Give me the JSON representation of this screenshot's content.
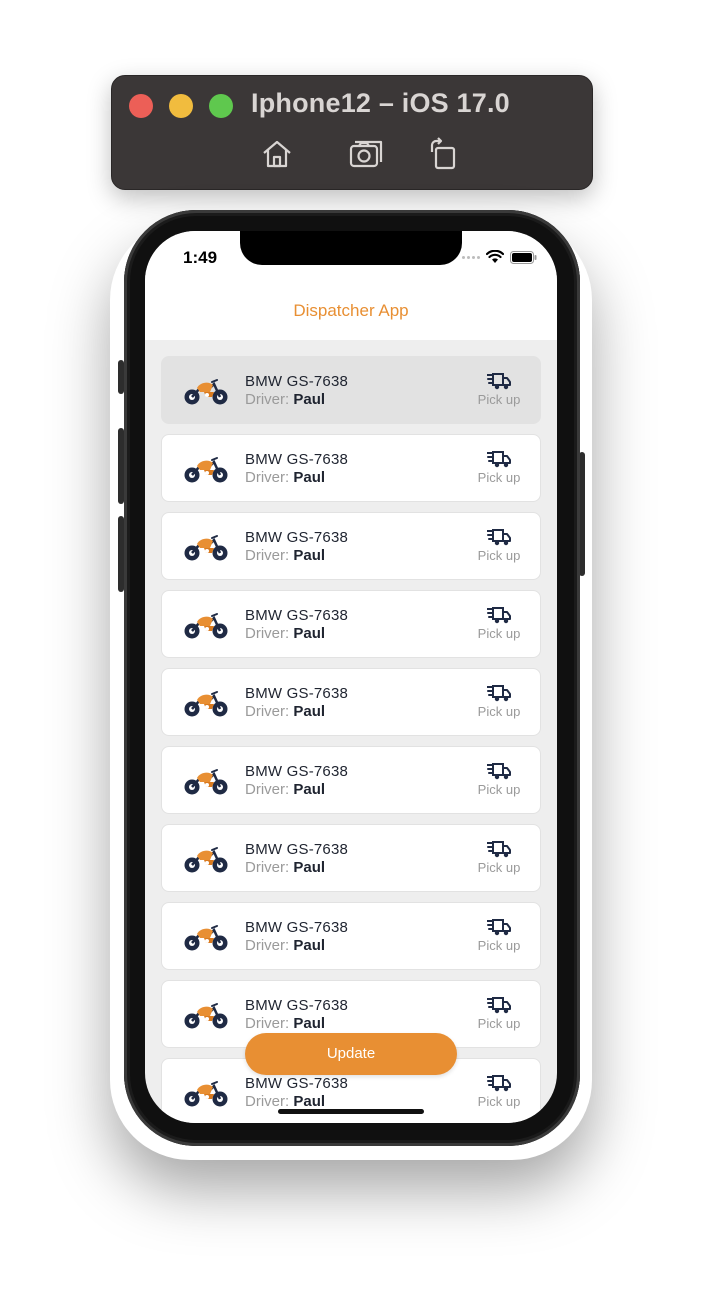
{
  "simulator": {
    "title": "Iphone12 – iOS 17.0",
    "tools": [
      "home-icon",
      "screenshot-icon",
      "rotate-icon"
    ]
  },
  "status_bar": {
    "time": "1:49"
  },
  "nav": {
    "title": "Dispatcher App"
  },
  "vehicles": [
    {
      "name": "BMW GS-7638",
      "driver_label": "Driver:",
      "driver": "Paul",
      "action": "Pick up",
      "selected": true
    },
    {
      "name": "BMW GS-7638",
      "driver_label": "Driver:",
      "driver": "Paul",
      "action": "Pick up",
      "selected": false
    },
    {
      "name": "BMW GS-7638",
      "driver_label": "Driver:",
      "driver": "Paul",
      "action": "Pick up",
      "selected": false
    },
    {
      "name": "BMW GS-7638",
      "driver_label": "Driver:",
      "driver": "Paul",
      "action": "Pick up",
      "selected": false
    },
    {
      "name": "BMW GS-7638",
      "driver_label": "Driver:",
      "driver": "Paul",
      "action": "Pick up",
      "selected": false
    },
    {
      "name": "BMW GS-7638",
      "driver_label": "Driver:",
      "driver": "Paul",
      "action": "Pick up",
      "selected": false
    },
    {
      "name": "BMW GS-7638",
      "driver_label": "Driver:",
      "driver": "Paul",
      "action": "Pick up",
      "selected": false
    },
    {
      "name": "BMW GS-7638",
      "driver_label": "Driver:",
      "driver": "Paul",
      "action": "Pick up",
      "selected": false
    },
    {
      "name": "BMW GS-7638",
      "driver_label": "Driver:",
      "driver": "Paul",
      "action": "Pick up",
      "selected": false
    },
    {
      "name": "BMW GS-7638",
      "driver_label": "Driver:",
      "driver": "Paul",
      "action": "Pick up",
      "selected": false
    }
  ],
  "update_button": {
    "label": "Update"
  },
  "colors": {
    "accent": "#e88f33",
    "selected_row": "#e2e2e2",
    "text_dark": "#1f2430"
  }
}
